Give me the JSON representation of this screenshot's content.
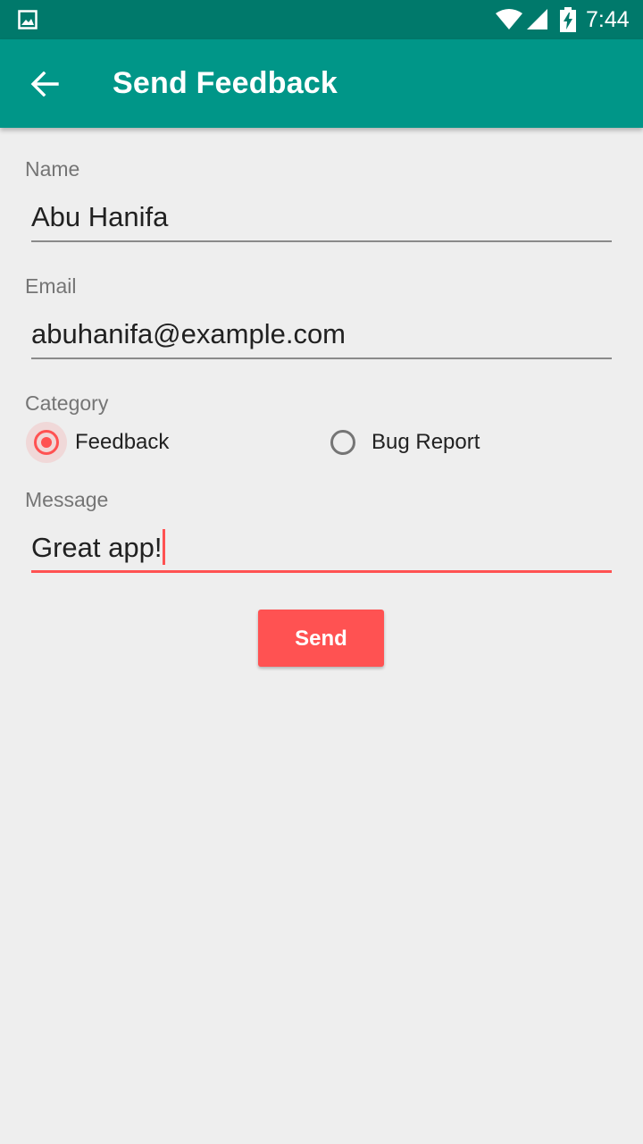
{
  "status_bar": {
    "time": "7:44",
    "icons": [
      "gallery-icon",
      "wifi-icon",
      "signal-icon",
      "battery-charging-icon"
    ],
    "background": "#00796b"
  },
  "app_bar": {
    "title": "Send Feedback",
    "back_icon": "arrow-back-icon",
    "background": "#009688"
  },
  "form": {
    "name": {
      "label": "Name",
      "value": "Abu Hanifa"
    },
    "email": {
      "label": "Email",
      "value": "abuhanifa@example.com"
    },
    "category": {
      "label": "Category",
      "options": [
        {
          "label": "Feedback",
          "checked": true
        },
        {
          "label": "Bug Report",
          "checked": false
        }
      ]
    },
    "message": {
      "label": "Message",
      "value": "Great app!",
      "focused": true
    }
  },
  "send_button": {
    "label": "Send"
  },
  "colors": {
    "accent": "#ff5252",
    "primary": "#009688",
    "primary_dark": "#00796b",
    "background": "#eeeeee"
  }
}
